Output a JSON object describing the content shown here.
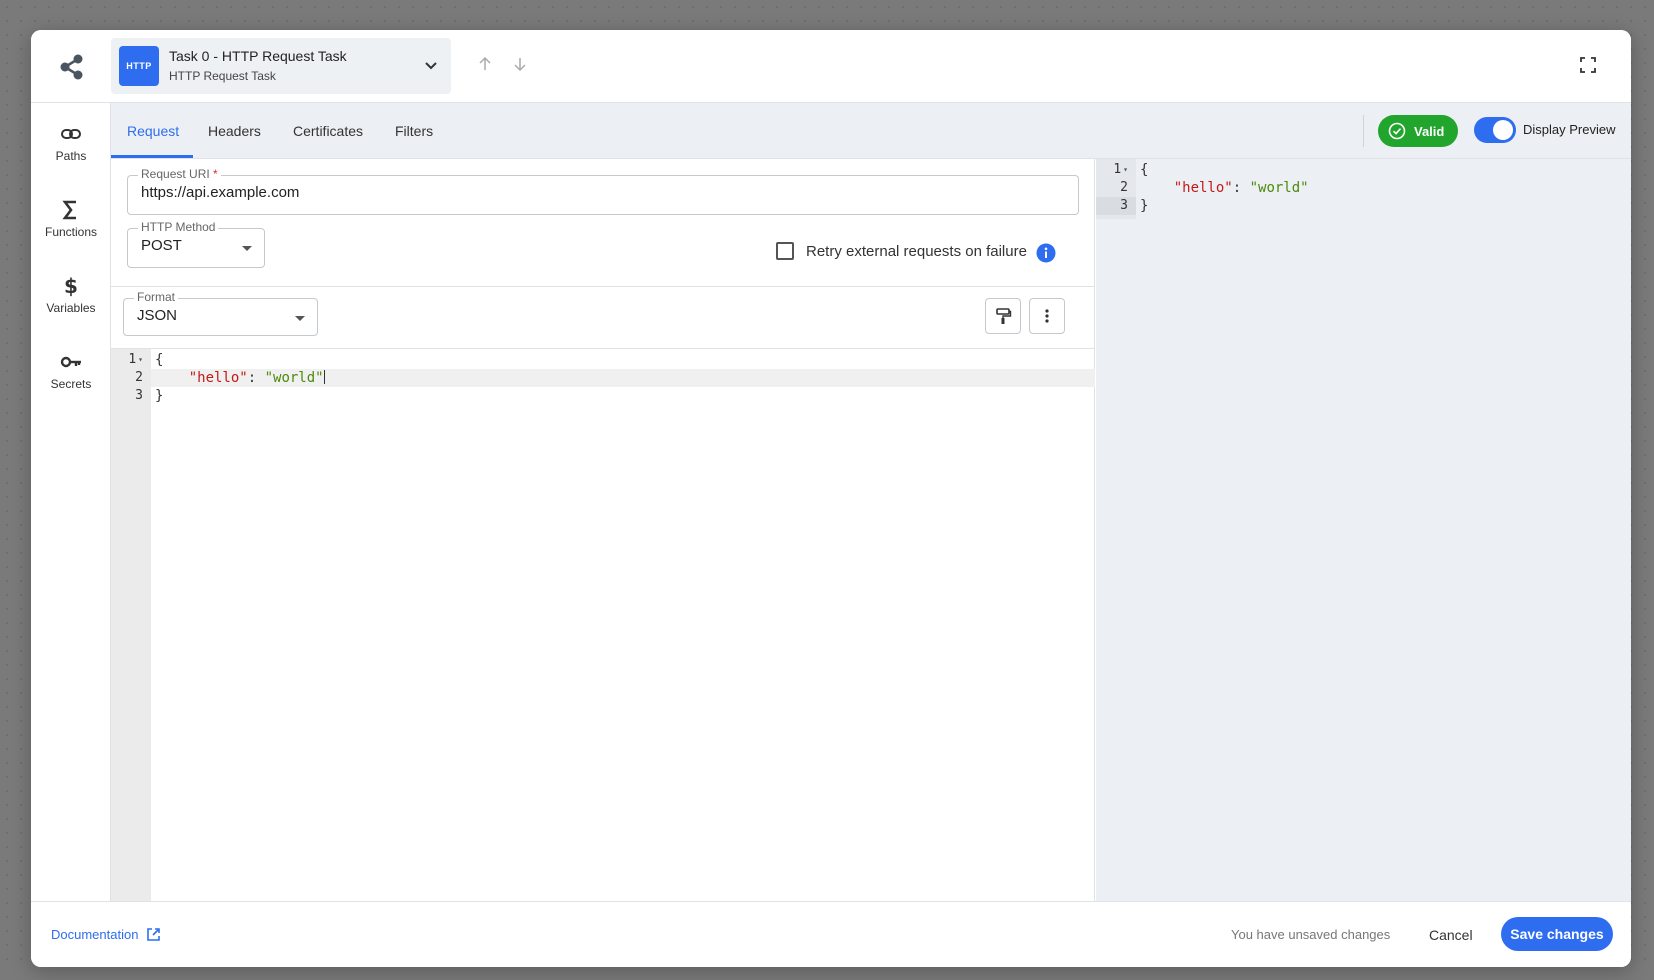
{
  "colors": {
    "accent": "#2f6df0",
    "valid": "#22a52c",
    "json_key": "#c41a16",
    "json_string": "#4d8a0a"
  },
  "header": {
    "logo_icon": "share-nodes-icon",
    "task_badge": "HTTP",
    "task_title": "Task 0 - HTTP Request Task",
    "task_subtitle": "HTTP Request Task",
    "chevron_icon": "chevron-down-icon",
    "up_icon": "arrow-up-icon",
    "down_icon": "arrow-down-icon",
    "expand_icon": "fullscreen-icon"
  },
  "sidebar": {
    "items": [
      {
        "label": "Paths",
        "icon": "link-icon"
      },
      {
        "label": "Functions",
        "icon": "sigma-icon"
      },
      {
        "label": "Variables",
        "icon": "dollar-icon"
      },
      {
        "label": "Secrets",
        "icon": "key-icon"
      }
    ]
  },
  "tabs": [
    {
      "label": "Request",
      "active": true
    },
    {
      "label": "Headers",
      "active": false
    },
    {
      "label": "Certificates",
      "active": false
    },
    {
      "label": "Filters",
      "active": false
    }
  ],
  "status": {
    "valid_label": "Valid",
    "display_preview_label": "Display Preview",
    "display_preview_on": true
  },
  "form": {
    "request_uri_label": "Request URI",
    "request_uri_required": "*",
    "request_uri_value": "https://api.example.com",
    "http_method_label": "HTTP Method",
    "http_method_value": "POST",
    "retry_label": "Retry external requests on failure",
    "retry_checked": false,
    "format_label": "Format",
    "format_value": "JSON"
  },
  "editor": {
    "lines": [
      {
        "num": "1",
        "text": "{"
      },
      {
        "num": "2",
        "key": "\"hello\"",
        "sep": ": ",
        "value": "\"world\""
      },
      {
        "num": "3",
        "text": "}"
      }
    ]
  },
  "preview": {
    "lines": [
      {
        "num": "1",
        "text": "{"
      },
      {
        "num": "2",
        "key": "\"hello\"",
        "sep": ": ",
        "value": "\"world\""
      },
      {
        "num": "3",
        "text": "}"
      }
    ]
  },
  "footer": {
    "documentation_label": "Documentation",
    "unsaved_label": "You have unsaved changes",
    "cancel_label": "Cancel",
    "save_label": "Save changes"
  }
}
